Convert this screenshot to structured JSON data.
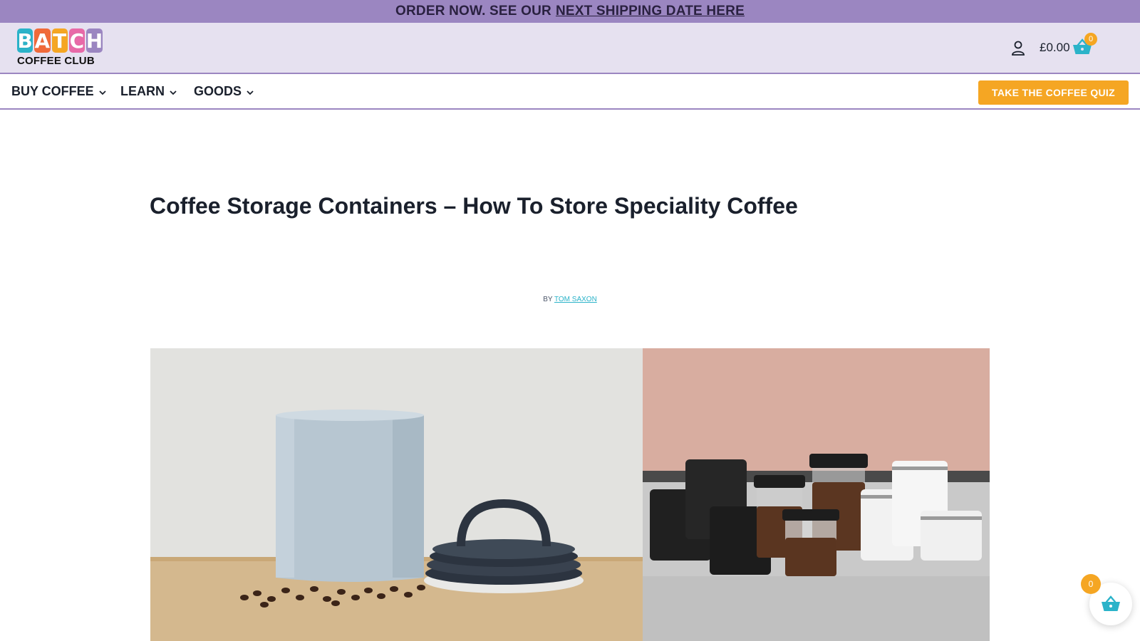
{
  "announcement": {
    "prefix": "ORDER NOW. SEE OUR",
    "link": "NEXT SHIPPING DATE HERE"
  },
  "header": {
    "logo": {
      "letters": [
        "B",
        "A",
        "T",
        "C",
        "H"
      ],
      "letter_colors": [
        "#2bb3c9",
        "#f06a3a",
        "#f5a623",
        "#e86aa8",
        "#9b86c1"
      ],
      "subtitle": "COFFEE CLUB"
    },
    "account_icon": "user-icon",
    "cart_total": "£0.00",
    "cart_icon": "basket-icon",
    "cart_count": "0"
  },
  "nav": {
    "items": [
      {
        "label": "BUY COFFEE"
      },
      {
        "label": "LEARN"
      },
      {
        "label": "GOODS"
      }
    ],
    "cta": "TAKE THE COFFEE QUIZ"
  },
  "article": {
    "title": "Coffee Storage Containers – How To Store Speciality Coffee",
    "byline_prefix": "BY",
    "author": "TOM SAXON"
  },
  "floating_cart": {
    "count": "0",
    "icon": "basket-icon"
  },
  "colors": {
    "accent_purple": "#9b86c1",
    "header_bg": "#e6e1f0",
    "cta_orange": "#f5a623",
    "basket_teal": "#2bb3c9"
  }
}
